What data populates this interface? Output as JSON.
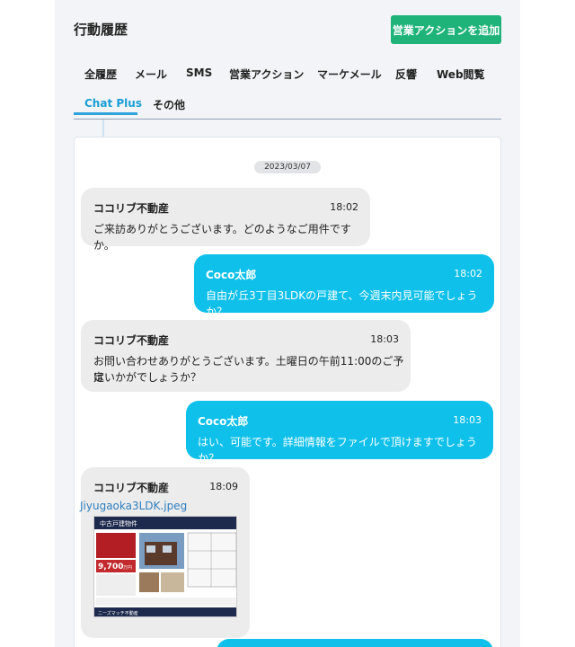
{
  "header": {
    "title": "行動履歴",
    "add_button_label": "営業アクションを追加"
  },
  "tabs": [
    {
      "label": "全履歴",
      "active": false
    },
    {
      "label": "メール",
      "active": false
    },
    {
      "label": "SMS",
      "active": false
    },
    {
      "label": "営業アクション",
      "active": false
    },
    {
      "label": "マーケメール",
      "active": false
    },
    {
      "label": "反響",
      "active": false
    },
    {
      "label": "Web閲覧",
      "active": false
    },
    {
      "label": "Chat Plus",
      "active": true
    },
    {
      "label": "その他",
      "active": false
    }
  ],
  "chat": {
    "date": "2023/03/07",
    "messages": [
      {
        "direction": "in",
        "sender": "ココリブ不動産",
        "time": "18:02",
        "lines": [
          "ご来訪ありがとうございます。どのようなご用件ですか。"
        ]
      },
      {
        "direction": "out",
        "sender": "Coco太郎",
        "time": "18:02",
        "lines": [
          "自由が丘3丁目3LDKの戸建て、今週末内見可能でしょうか？"
        ]
      },
      {
        "direction": "in",
        "sender": "ココリブ不動産",
        "time": "18:03",
        "lines": [
          "お問い合わせありがとうございます。土曜日の午前11:00のご予定",
          "はいかがでしょうか？"
        ]
      },
      {
        "direction": "out",
        "sender": "Coco太郎",
        "time": "18:03",
        "lines": [
          "はい、可能です。詳細情報をファイルで頂けますでしょうか？"
        ]
      },
      {
        "direction": "in",
        "sender": "ココリブ不動産",
        "time": "18:09",
        "file_name": "Jiyugaoka3LDK.jpeg"
      }
    ]
  },
  "flyer": {
    "heading": "中古戸建物件",
    "price": "9,700",
    "price_unit": "万円",
    "company": "ニーズマッチ不動産"
  },
  "colors": {
    "add_button": "#1fb37a",
    "active_tab": "#1a9fd6",
    "outgoing_bubble": "#0ec0ea",
    "incoming_bubble": "#ececec"
  }
}
